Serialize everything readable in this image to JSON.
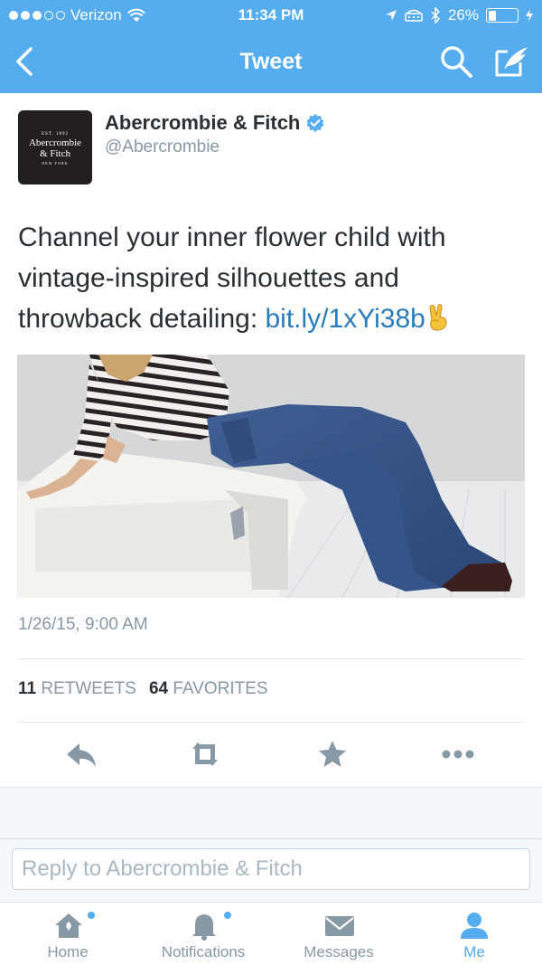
{
  "status_bar": {
    "carrier": "Verizon",
    "time": "11:34 PM",
    "battery_percent": "26%",
    "battery_level": 0.26,
    "signal_dots_filled": 3,
    "icons": [
      "wifi-icon",
      "location-icon",
      "tty-icon",
      "bluetooth-icon",
      "battery-icon",
      "charging-icon"
    ]
  },
  "nav": {
    "title": "Tweet",
    "icons": [
      "back-chevron-icon",
      "search-icon",
      "compose-icon"
    ]
  },
  "tweet": {
    "author_name": "Abercrombie & Fitch",
    "author_handle": "@Abercrombie",
    "avatar": {
      "est": "EST. 1892",
      "line1": "Abercrombie",
      "line2": "& Fitch",
      "city": "NEW YORK"
    },
    "text_part1": "Channel your inner flower child with vintage-inspired silhouettes and throwback detailing: ",
    "link": "bit.ly/1xYi38b",
    "emoji": "victory-hand-emoji",
    "timestamp": "1/26/15, 9:00 AM",
    "retweets_count": "11",
    "retweets_label": "RETWEETS",
    "favorites_count": "64",
    "favorites_label": "FAVORITES"
  },
  "actions": [
    "reply-icon",
    "retweet-icon",
    "favorite-icon",
    "more-icon"
  ],
  "reply": {
    "placeholder": "Reply to Abercrombie & Fitch"
  },
  "tabbar": {
    "tabs": [
      {
        "label": "Home",
        "icon": "home-icon"
      },
      {
        "label": "Notifications",
        "icon": "bell-icon"
      },
      {
        "label": "Messages",
        "icon": "envelope-icon"
      },
      {
        "label": "Me",
        "icon": "person-icon"
      }
    ]
  },
  "colors": {
    "brand_blue": "#55acee",
    "link_blue": "#2b7bb9",
    "muted_gray": "#8899a6"
  }
}
